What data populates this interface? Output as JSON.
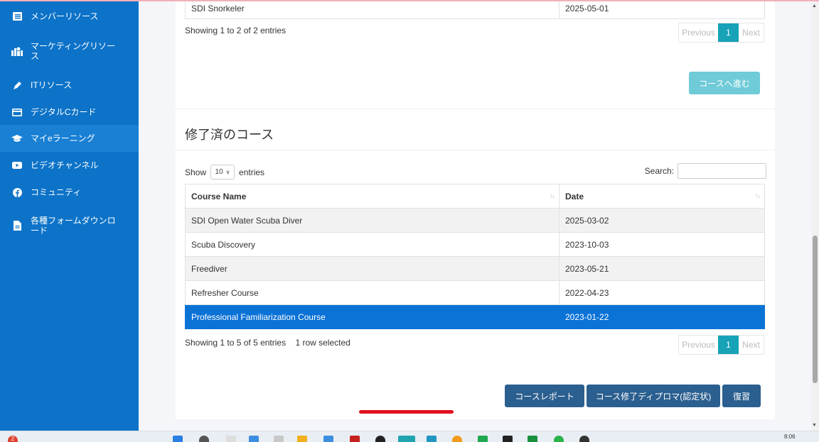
{
  "sidebar": {
    "items": [
      {
        "label": "メンバーリソース",
        "icon": "list-icon"
      },
      {
        "label": "マーケティングリソース",
        "icon": "marketing-icon"
      },
      {
        "label": "ITリソース",
        "icon": "pen-icon"
      },
      {
        "label": "デジタルCカード",
        "icon": "card-icon"
      },
      {
        "label": "マイeラーニング",
        "icon": "graduation-cap-icon",
        "active": true
      },
      {
        "label": "ビデオチャンネル",
        "icon": "youtube-icon"
      },
      {
        "label": "コミュニティ",
        "icon": "facebook-icon"
      },
      {
        "label": "各種フォームダウンロード",
        "icon": "file-icon"
      }
    ]
  },
  "top_table": {
    "last_row": {
      "course": "SDI Snorkeler",
      "date": "2025-05-01"
    },
    "info": "Showing 1 to 2 of 2 entries",
    "pager": {
      "prev": "Previous",
      "page": "1",
      "next": "Next"
    },
    "proceed_button": "コースへ進む"
  },
  "completed": {
    "title": "修了済のコース",
    "show_label": "Show",
    "show_value": "10",
    "entries_label": "entries",
    "search_label": "Search:",
    "search_value": "",
    "columns": [
      "Course Name",
      "Date"
    ],
    "rows": [
      {
        "course": "SDI Open Water Scuba Diver",
        "date": "2025-03-02"
      },
      {
        "course": "Scuba Discovery",
        "date": "2023-10-03"
      },
      {
        "course": "Freediver",
        "date": "2023-05-21"
      },
      {
        "course": "Refresher Course",
        "date": "2022-04-23"
      },
      {
        "course": "Professional Familiarization Course",
        "date": "2023-01-22",
        "selected": true
      }
    ],
    "info": "Showing 1 to 5 of 5 entries",
    "selected_info": "1 row selected",
    "pager": {
      "prev": "Previous",
      "page": "1",
      "next": "Next"
    },
    "buttons": {
      "report": "コースレポート",
      "diploma": "コース修了ディプロマ(認定状)",
      "review": "復習"
    }
  },
  "taskbar": {
    "badge": "2",
    "clock": "8:06"
  },
  "colors": {
    "sidebar": "#0d73c8",
    "selected_row": "#0b72d6",
    "pager_active": "#17a2b8",
    "dark_button": "#2b5f8f",
    "underline": "#e0101d"
  }
}
